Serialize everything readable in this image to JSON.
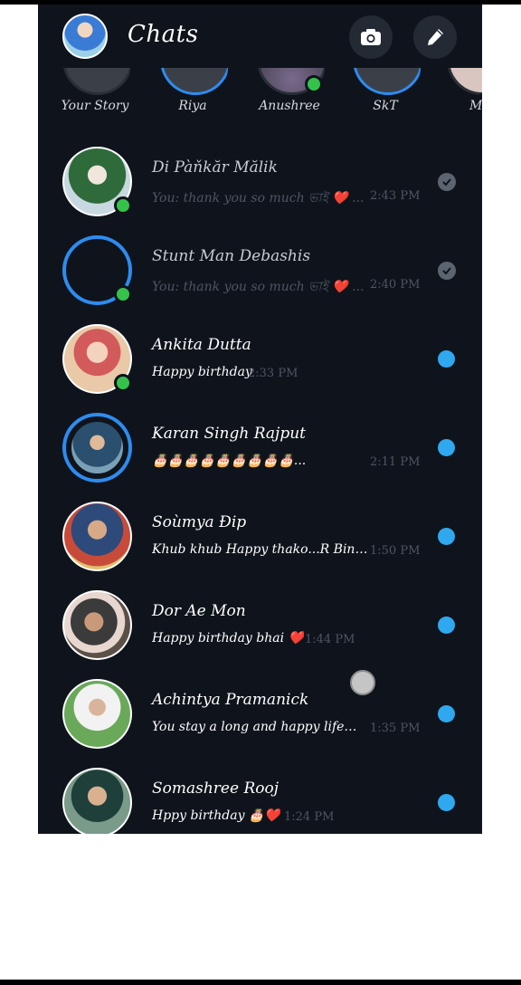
{
  "header": {
    "title": "Chats",
    "camera_icon": "camera-icon",
    "compose_icon": "pencil-icon"
  },
  "stories": [
    {
      "label": "Your Story"
    },
    {
      "label": "Riya"
    },
    {
      "label": "Anushree"
    },
    {
      "label": "SkT"
    },
    {
      "label": "Mo"
    }
  ],
  "chats": [
    {
      "name": "Di Pàňkăr Mălik",
      "preview": "You: thank you so much ভাই ❤️ ...",
      "time": "2:43 PM",
      "status": "read",
      "online": true
    },
    {
      "name": "Stunt Man Debashis",
      "preview": "You: thank you so much ভাই ❤️ ...",
      "time": "2:40 PM",
      "status": "read",
      "online": true
    },
    {
      "name": "Ankita Dutta",
      "preview": "Happy birthday",
      "time": "2:33 PM",
      "status": "unread",
      "online": true
    },
    {
      "name": "Karan Singh Rajput",
      "preview": "🎂🎂🎂🎂🎂🎂🎂🎂🎂...",
      "time": "2:11 PM",
      "status": "unread",
      "online": false
    },
    {
      "name": "Soùmya Đip",
      "preview": "Khub khub Happy thako...R Bindass ...",
      "time": "1:50 PM",
      "status": "unread",
      "online": false
    },
    {
      "name": "Dor Ae Mon",
      "preview": "Happy birthday bhai ❤️",
      "time": "1:44 PM",
      "status": "unread",
      "online": false
    },
    {
      "name": "Achintya Pramanick",
      "preview": "You stay a long and happy life😍...",
      "time": "1:35 PM",
      "status": "unread",
      "online": false
    },
    {
      "name": "Somashree Rooj",
      "preview": "Hppy birthday 🎂❤️",
      "time": "1:24 PM",
      "status": "unread",
      "online": false
    }
  ],
  "colors": {
    "background": "#0f141c",
    "accent_blue": "#2fa8f0",
    "online_green": "#35c24a",
    "muted_text": "#4d5563"
  }
}
